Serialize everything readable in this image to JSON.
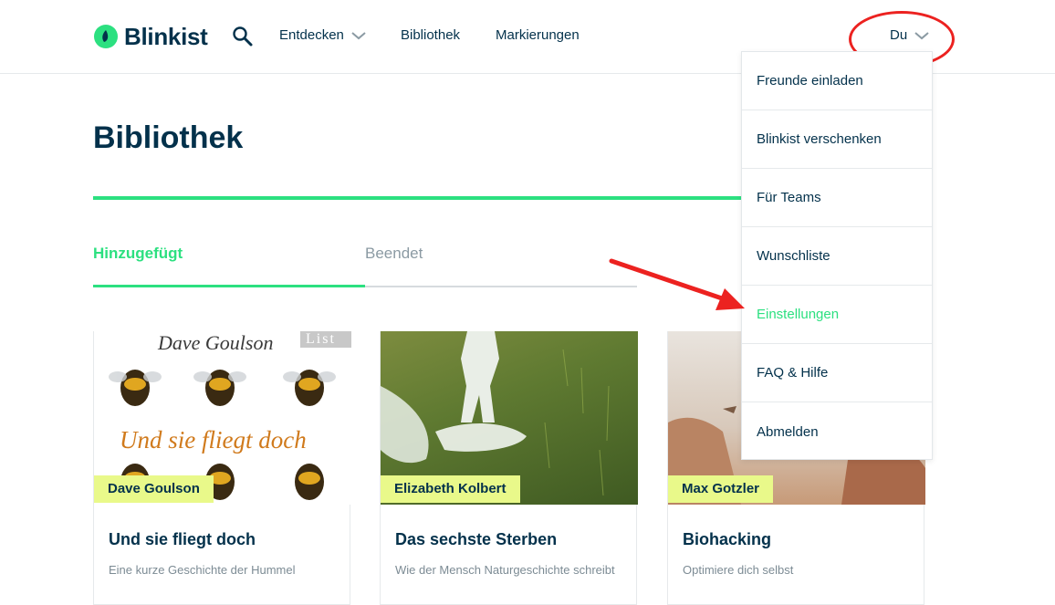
{
  "header": {
    "brand": "Blinkist",
    "nav": {
      "discover": "Entdecken",
      "library": "Bibliothek",
      "highlights": "Markierungen"
    },
    "user": "Du"
  },
  "page": {
    "title": "Bibliothek",
    "tabs": [
      {
        "label": "Hinzugefügt",
        "active": true
      },
      {
        "label": "Beendet",
        "active": false
      }
    ]
  },
  "cards": [
    {
      "author": "Dave Goulson",
      "title": "Und sie fliegt doch",
      "subtitle": "Eine kurze Geschichte der Hummel",
      "cover_author": "Dave Goulson",
      "cover_publisher": "List",
      "cover_title": "Und sie fliegt doch"
    },
    {
      "author": "Elizabeth Kolbert",
      "title": "Das sechste Sterben",
      "subtitle": "Wie der Mensch Naturgeschichte schreibt"
    },
    {
      "author": "Max Gotzler",
      "title": "Biohacking",
      "subtitle": "Optimiere dich selbst"
    }
  ],
  "dropdown": {
    "items": [
      {
        "label": "Freunde einladen"
      },
      {
        "label": "Blinkist verschenken"
      },
      {
        "label": "Für Teams"
      },
      {
        "label": "Wunschliste"
      },
      {
        "label": "Einstellungen",
        "active": true
      },
      {
        "label": "FAQ & Hilfe"
      },
      {
        "label": "Abmelden"
      }
    ]
  },
  "colors": {
    "accent": "#2ce080",
    "navy": "#03314b",
    "author_tag": "#e9f98a",
    "annotation": "#ec2220"
  },
  "icons": {
    "logo": "blinkist-leaf-icon",
    "search": "search-icon",
    "chevron": "chevron-down-icon"
  }
}
